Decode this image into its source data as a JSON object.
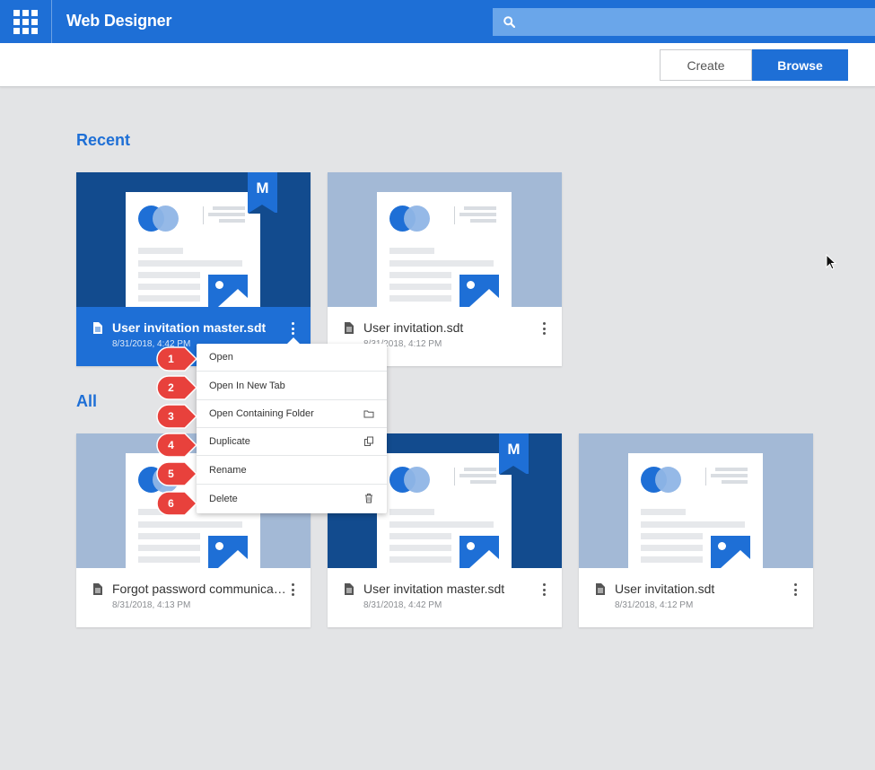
{
  "app": {
    "title": "Web Designer",
    "search_placeholder": ""
  },
  "toolbar": {
    "create_label": "Create",
    "browse_label": "Browse"
  },
  "sections": {
    "recent": "Recent",
    "all": "All"
  },
  "recent_cards": [
    {
      "name": "User invitation master.sdt",
      "date": "8/31/2018, 4:42 PM",
      "badge": "M",
      "selected": true
    },
    {
      "name": "User invitation.sdt",
      "date": "8/31/2018, 4:12 PM"
    }
  ],
  "all_cards": [
    {
      "name": "Forgot password communication.sdt",
      "date": "8/31/2018, 4:13 PM"
    },
    {
      "name": "User invitation master.sdt",
      "date": "8/31/2018, 4:42 PM",
      "badge": "M"
    },
    {
      "name": "User invitation.sdt",
      "date": "8/31/2018, 4:12 PM"
    }
  ],
  "context_menu": [
    {
      "label": "Open",
      "marker": "1"
    },
    {
      "label": "Open In New Tab",
      "marker": "2"
    },
    {
      "label": "Open Containing Folder",
      "marker": "3",
      "icon": "folder-icon"
    },
    {
      "label": "Duplicate",
      "marker": "4",
      "icon": "duplicate-icon"
    },
    {
      "label": "Rename",
      "marker": "5"
    },
    {
      "label": "Delete",
      "marker": "6",
      "icon": "trash-icon"
    }
  ],
  "colors": {
    "accent": "#1e6fd6",
    "master_thumb": "#124b8e",
    "thumb": "#a3b9d6",
    "marker": "#e8413c"
  }
}
